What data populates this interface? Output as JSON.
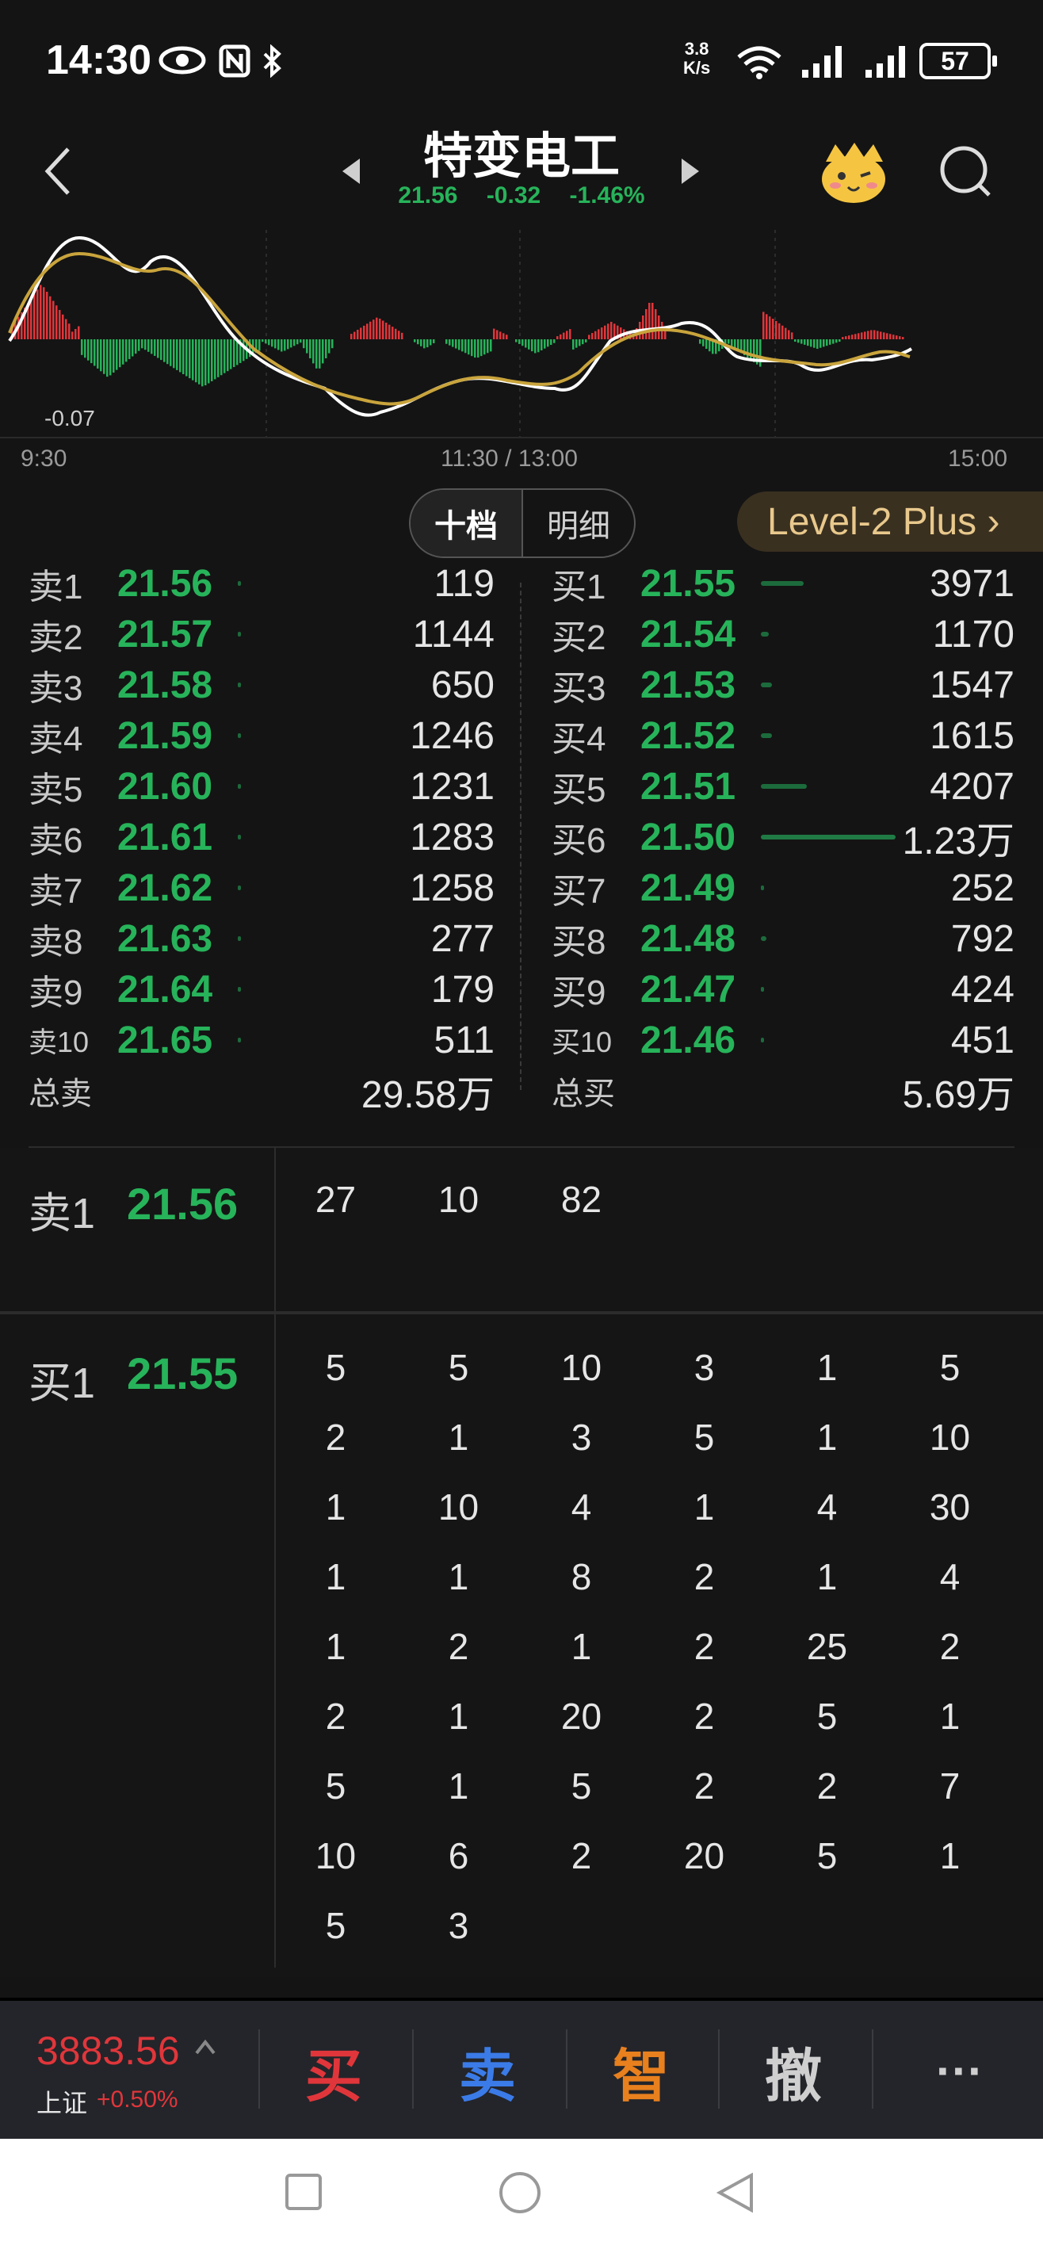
{
  "status_bar": {
    "time": "14:30",
    "net_speed_top": "3.8",
    "net_speed_bottom": "K/s",
    "battery": "57"
  },
  "header": {
    "title": "特变电工",
    "price": "21.56",
    "change": "-0.32",
    "change_pct": "-1.46%"
  },
  "chart": {
    "min_label": "-0.07",
    "time_labels": [
      "9:30",
      "11:30 / 13:00",
      "15:00"
    ]
  },
  "tabs": {
    "depth": "十档",
    "detail": "明细",
    "level2": "Level-2 Plus ›"
  },
  "colors": {
    "up": "#e0363b",
    "down": "#27b35a",
    "accent": "#e8c88c"
  },
  "ask": [
    {
      "label": "卖1",
      "price": "21.56",
      "vol": "119",
      "bar": 0.02
    },
    {
      "label": "卖2",
      "price": "21.57",
      "vol": "1144",
      "bar": 0.06
    },
    {
      "label": "卖3",
      "price": "21.58",
      "vol": "650",
      "bar": 0.04
    },
    {
      "label": "卖4",
      "price": "21.59",
      "vol": "1246",
      "bar": 0.06
    },
    {
      "label": "卖5",
      "price": "21.60",
      "vol": "1231",
      "bar": 0.06
    },
    {
      "label": "卖6",
      "price": "21.61",
      "vol": "1283",
      "bar": 0.06
    },
    {
      "label": "卖7",
      "price": "21.62",
      "vol": "1258",
      "bar": 0.06
    },
    {
      "label": "卖8",
      "price": "21.63",
      "vol": "277",
      "bar": 0.02
    },
    {
      "label": "卖9",
      "price": "21.64",
      "vol": "179",
      "bar": 0.02
    },
    {
      "label": "卖10",
      "price": "21.65",
      "vol": "511",
      "bar": 0.03
    }
  ],
  "ask_total": {
    "label": "总卖",
    "value": "29.58万"
  },
  "bid": [
    {
      "label": "买1",
      "price": "21.55",
      "vol": "3971",
      "bar": 0.32
    },
    {
      "label": "买2",
      "price": "21.54",
      "vol": "1170",
      "bar": 0.06
    },
    {
      "label": "买3",
      "price": "21.53",
      "vol": "1547",
      "bar": 0.08
    },
    {
      "label": "买4",
      "price": "21.52",
      "vol": "1615",
      "bar": 0.08
    },
    {
      "label": "买5",
      "price": "21.51",
      "vol": "4207",
      "bar": 0.34
    },
    {
      "label": "买6",
      "price": "21.50",
      "vol": "1.23万",
      "bar": 1.0
    },
    {
      "label": "买7",
      "price": "21.49",
      "vol": "252",
      "bar": 0.02
    },
    {
      "label": "买8",
      "price": "21.48",
      "vol": "792",
      "bar": 0.04
    },
    {
      "label": "买9",
      "price": "21.47",
      "vol": "424",
      "bar": 0.02
    },
    {
      "label": "买10",
      "price": "21.46",
      "vol": "451",
      "bar": 0.02
    }
  ],
  "bid_total": {
    "label": "总买",
    "value": "5.69万"
  },
  "queue_sell": {
    "label": "卖1",
    "price": "21.56",
    "orders": [
      "27",
      "10",
      "82"
    ]
  },
  "queue_buy": {
    "label": "买1",
    "price": "21.55",
    "orders": [
      "5",
      "5",
      "10",
      "3",
      "1",
      "5",
      "2",
      "1",
      "3",
      "5",
      "1",
      "10",
      "1",
      "10",
      "4",
      "1",
      "4",
      "30",
      "1",
      "1",
      "8",
      "2",
      "1",
      "4",
      "1",
      "2",
      "1",
      "2",
      "25",
      "2",
      "2",
      "1",
      "20",
      "2",
      "5",
      "1",
      "5",
      "1",
      "5",
      "2",
      "2",
      "7",
      "10",
      "6",
      "2",
      "20",
      "5",
      "1",
      "5",
      "3"
    ]
  },
  "bottom": {
    "index_value": "3883.56",
    "index_name": "上证",
    "index_change": "+0.50%",
    "buy": "买",
    "sell": "卖",
    "smart": "智",
    "cancel": "撤",
    "more": "···"
  }
}
